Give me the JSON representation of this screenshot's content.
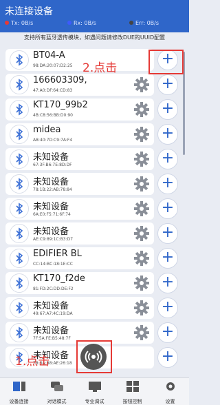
{
  "header": {
    "title": "未连接设备",
    "tx": "Tx: 0B/s",
    "rx": "Rx: 0B/s",
    "err": "Err: 0B/s",
    "colors": {
      "tx": "#e53935",
      "rx": "#3d5afe",
      "err": "#444444"
    }
  },
  "tip": "支持所有蓝牙透传模块，如遇问题请修改DUE的UUID配置",
  "devices": [
    {
      "name": "BT04-A",
      "mac": "98:DA:20:07:D2:25",
      "icon": "bluetooth-icon",
      "gear": false
    },
    {
      "name": "166603309,",
      "mac": "47:A0:DF:64:CD:83",
      "icon": "bluetooth-le-icon",
      "gear": true
    },
    {
      "name": "KT170_99b2",
      "mac": "4B:C8:56:BB:D0:90",
      "icon": "bluetooth-le-icon",
      "gear": true
    },
    {
      "name": "midea",
      "mac": "A8:40:7D:C9:7A:F4",
      "icon": "bluetooth-le-icon",
      "gear": true
    },
    {
      "name": "未知设备",
      "mac": "67:3F:B6:7E:8D:DF",
      "icon": "bluetooth-le-icon",
      "gear": true
    },
    {
      "name": "未知设备",
      "mac": "78:1B:22:AB:78:84",
      "icon": "bluetooth-le-icon",
      "gear": true
    },
    {
      "name": "未知设备",
      "mac": "6A:E0:F5:71:6F:74",
      "icon": "bluetooth-le-icon",
      "gear": true
    },
    {
      "name": "未知设备",
      "mac": "AE:C9:89:1C:B3:D7",
      "icon": "bluetooth-le-icon",
      "gear": true
    },
    {
      "name": "EDIFIER BL",
      "mac": "CC:14:BC:18:1E:CC",
      "icon": "bluetooth-le-icon",
      "gear": true
    },
    {
      "name": "KT170_f2de",
      "mac": "81:FD:2C:DD:DE:F2",
      "icon": "bluetooth-le-icon",
      "gear": true
    },
    {
      "name": "未知设备",
      "mac": "49:67:A7:4C:19:DA",
      "icon": "bluetooth-le-icon",
      "gear": true
    },
    {
      "name": "未知设备",
      "mac": "7F:5A:FE:B5:48:7F",
      "icon": "bluetooth-le-icon",
      "gear": true
    },
    {
      "name": "未知设备",
      "mac": "78:3A:B8:AE:26:18",
      "icon": "bluetooth-le-icon",
      "gear": false
    }
  ],
  "annotations": {
    "step1": "1.点击",
    "step2": "2.点击"
  },
  "tabs": [
    {
      "label": "设备连接",
      "icon": "device-connect-icon"
    },
    {
      "label": "对话模式",
      "icon": "chat-icon"
    },
    {
      "label": "专业调试",
      "icon": "debug-icon"
    },
    {
      "label": "按钮控制",
      "icon": "button-grid-icon"
    },
    {
      "label": "设置",
      "icon": "settings-icon"
    }
  ]
}
